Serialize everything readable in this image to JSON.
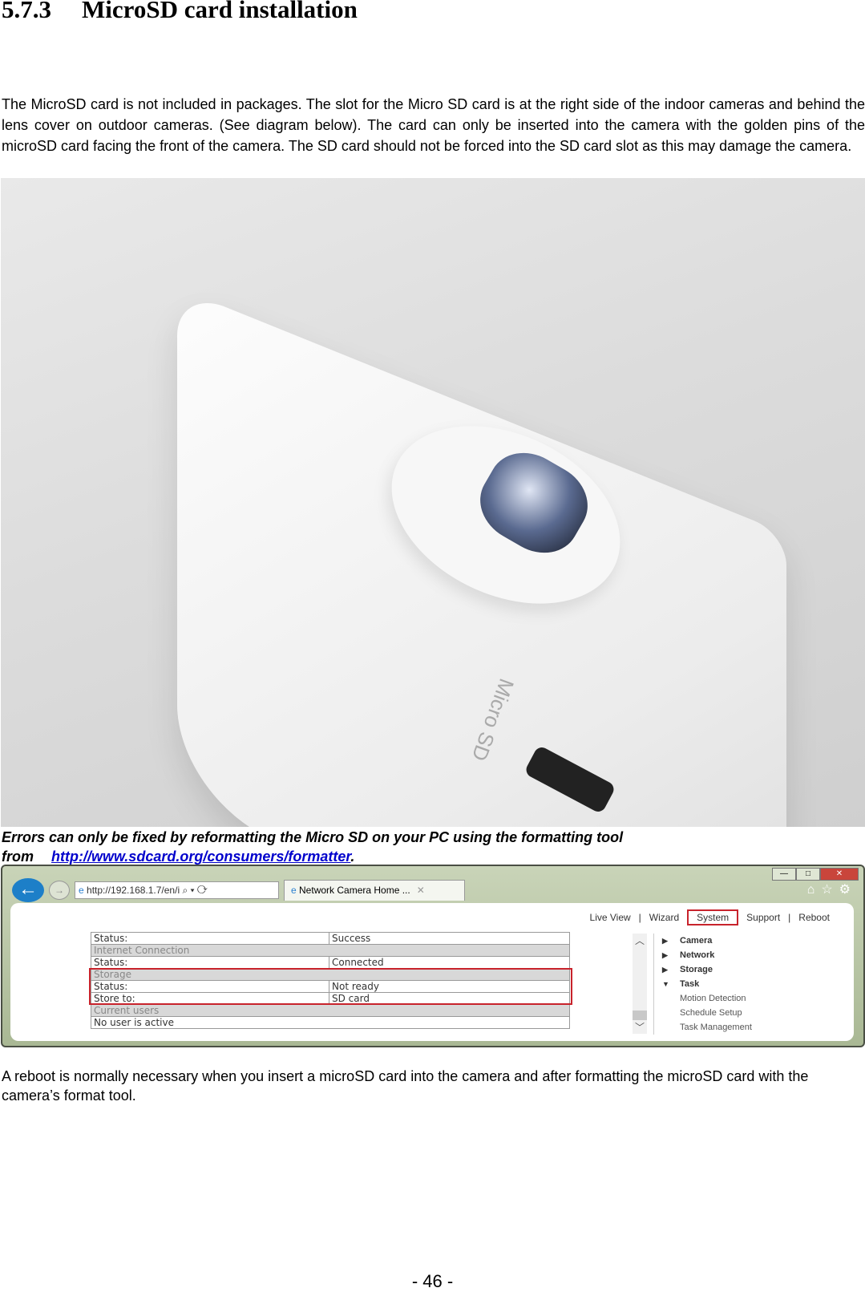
{
  "heading": {
    "number": "5.7.3",
    "title": "MicroSD card installation"
  },
  "intro": "The MicroSD card is not included in packages. The slot for the Micro SD card is at the right side of the indoor cameras and behind the lens cover on outdoor cameras. (See diagram below). The card can only be inserted into the camera with the golden pins of the microSD card facing the front of the camera. The SD card should not be forced into the SD card slot as this may damage the camera.",
  "photo": {
    "slot_label": "Micro SD"
  },
  "caption": {
    "line1": "Errors can only be fixed by reformatting the Micro SD on your PC using the formatting tool",
    "from": "from",
    "link": "http://www.sdcard.org/consumers/formatter",
    "period": "."
  },
  "browser": {
    "address": "http://192.168.1.7/en/i",
    "tab": "Network Camera Home ...",
    "nav": [
      "Live View",
      "|",
      "Wizard",
      "System",
      "Support",
      "|",
      "Reboot"
    ],
    "table": [
      {
        "label": "Status:",
        "value": "Success",
        "header": false
      },
      {
        "label": "Internet Connection",
        "value": "",
        "header": true
      },
      {
        "label": "Status:",
        "value": "Connected",
        "header": false
      },
      {
        "label": "Storage",
        "value": "",
        "header": true
      },
      {
        "label": "Status:",
        "value": "Not ready",
        "header": false
      },
      {
        "label": "Store to:",
        "value": "SD card",
        "header": false
      },
      {
        "label": "Current users",
        "value": "",
        "header": true
      },
      {
        "label": "No user is active",
        "value": "",
        "header": false
      }
    ],
    "menu": {
      "camera": "Camera",
      "network": "Network",
      "storage": "Storage",
      "task": "Task",
      "motion": "Motion Detection",
      "schedule": "Schedule Setup",
      "task_mgmt": "Task Management"
    },
    "highlight_color": "#c8232c"
  },
  "outro": "A reboot is normally necessary when you insert a microSD card into the camera and after formatting the microSD card with the camera’s format tool.",
  "page_number": "- 46 -"
}
